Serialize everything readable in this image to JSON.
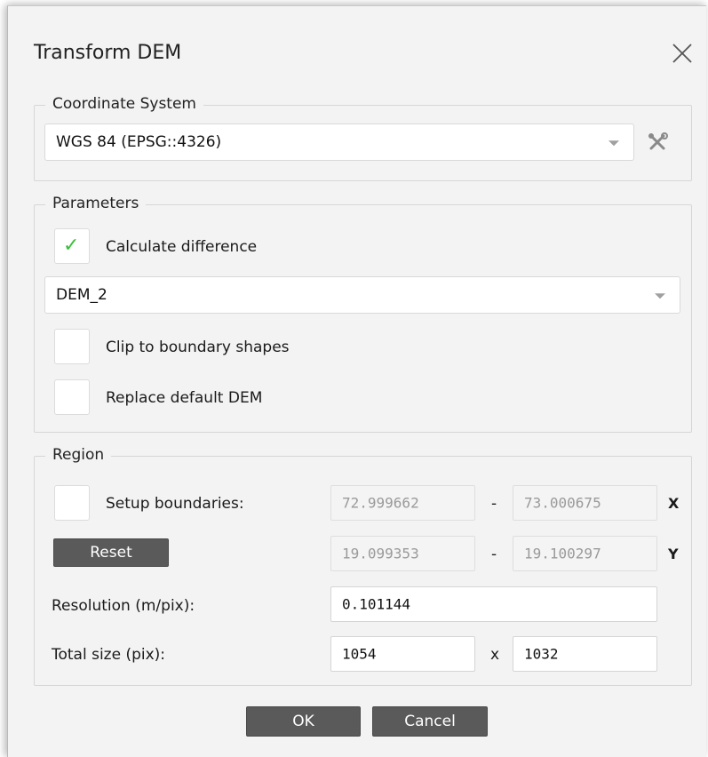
{
  "dialog": {
    "title": "Transform DEM",
    "close_icon": "close-icon"
  },
  "coordinate_system": {
    "legend": "Coordinate System",
    "selected": "WGS 84 (EPSG::4326)",
    "settings_icon": "tools-icon"
  },
  "parameters": {
    "legend": "Parameters",
    "calculate_difference": {
      "label": "Calculate difference",
      "checked": true
    },
    "dem_select": "DEM_2",
    "clip_to_boundary": {
      "label": "Clip to boundary shapes",
      "checked": false
    },
    "replace_default": {
      "label": "Replace default DEM",
      "checked": false
    }
  },
  "region": {
    "legend": "Region",
    "setup_boundaries": {
      "label": "Setup boundaries:",
      "checked": false
    },
    "x_min": "72.999662",
    "x_max": "73.000675",
    "x_axis": "X",
    "y_min": "19.099353",
    "y_max": "19.100297",
    "y_axis": "Y",
    "range_separator": "-",
    "reset_label": "Reset",
    "resolution_label": "Resolution (m/pix):",
    "resolution_value": "0.101144",
    "total_size_label": "Total size (pix):",
    "total_width": "1054",
    "total_height": "1032",
    "size_separator": "x"
  },
  "footer": {
    "ok_label": "OK",
    "cancel_label": "Cancel"
  },
  "colors": {
    "check": "#3bbf3b",
    "button_dark": "#5a5a5a",
    "dialog_bg": "#f3f3f3"
  }
}
